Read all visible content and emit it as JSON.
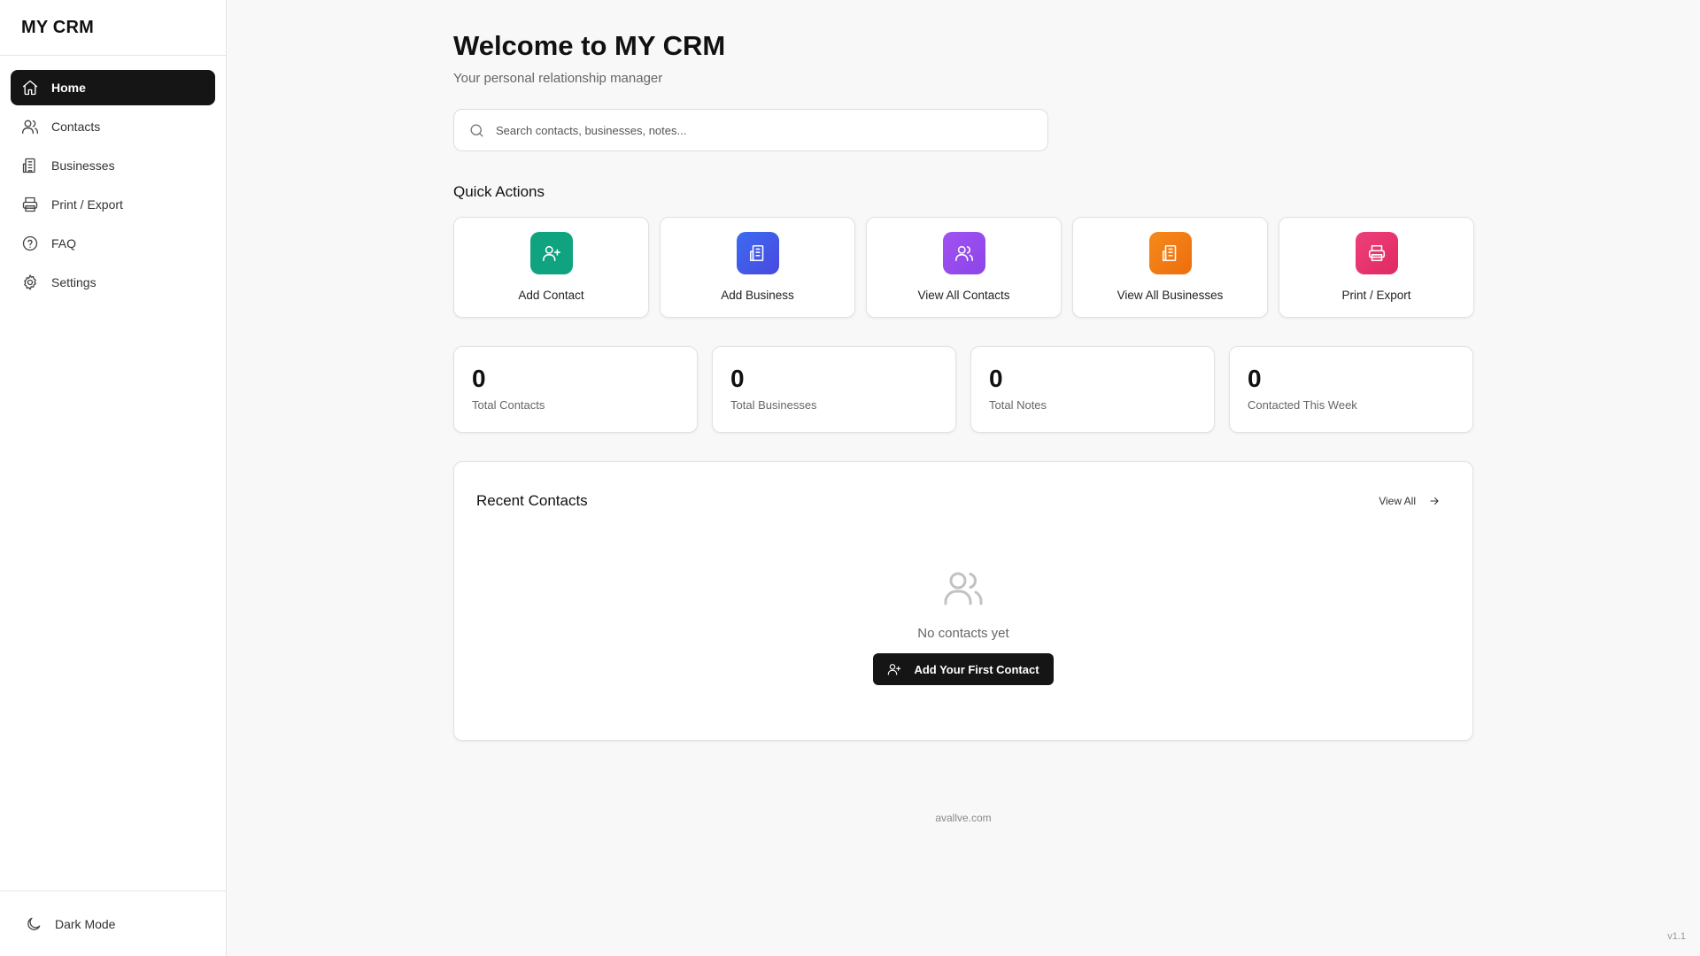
{
  "app": {
    "title": "MY CRM",
    "version": "v1.1"
  },
  "sidebar": {
    "items": [
      {
        "label": "Home",
        "icon": "home-icon",
        "active": true
      },
      {
        "label": "Contacts",
        "icon": "users-icon",
        "active": false
      },
      {
        "label": "Businesses",
        "icon": "building-icon",
        "active": false
      },
      {
        "label": "Print / Export",
        "icon": "printer-icon",
        "active": false
      },
      {
        "label": "FAQ",
        "icon": "help-circle-icon",
        "active": false
      },
      {
        "label": "Settings",
        "icon": "gear-icon",
        "active": false
      }
    ],
    "footer": {
      "dark_mode_label": "Dark Mode",
      "icon": "moon-icon"
    }
  },
  "header": {
    "title": "Welcome to MY CRM",
    "subtitle": "Your personal relationship manager"
  },
  "search": {
    "placeholder": "Search contacts, businesses, notes...",
    "value": ""
  },
  "quick_actions": {
    "title": "Quick Actions",
    "items": [
      {
        "label": "Add Contact",
        "icon": "user-plus-icon",
        "color": "#10a37f"
      },
      {
        "label": "Add Business",
        "icon": "building-icon",
        "color": "#3b5bea"
      },
      {
        "label": "View All Contacts",
        "icon": "users-icon",
        "color": "#9b4ef0"
      },
      {
        "label": "View All Businesses",
        "icon": "building-icon",
        "color": "#f07a12"
      },
      {
        "label": "Print / Export",
        "icon": "printer-icon",
        "color": "#e8336f"
      }
    ]
  },
  "stats": [
    {
      "value": "0",
      "label": "Total Contacts"
    },
    {
      "value": "0",
      "label": "Total Businesses"
    },
    {
      "value": "0",
      "label": "Total Notes"
    },
    {
      "value": "0",
      "label": "Contacted This Week"
    }
  ],
  "recent_contacts": {
    "title": "Recent Contacts",
    "view_all_label": "View All",
    "empty_text": "No contacts yet",
    "add_first_label": "Add Your First Contact"
  },
  "footer": {
    "link_text": "avallve.com"
  }
}
